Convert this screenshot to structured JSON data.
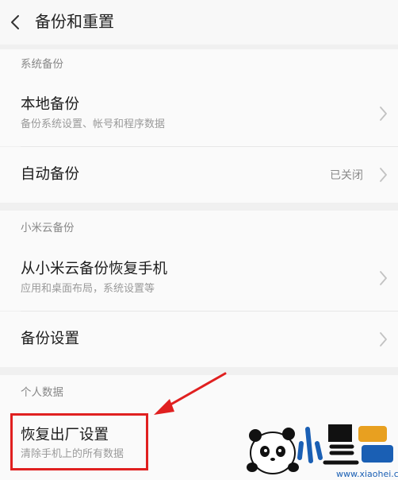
{
  "header": {
    "title": "备份和重置"
  },
  "sections": {
    "system_backup": {
      "title": "系统备份",
      "local_backup": {
        "label": "本地备份",
        "subtitle": "备份系统设置、帐号和程序数据"
      },
      "auto_backup": {
        "label": "自动备份",
        "value": "已关闭"
      }
    },
    "cloud_backup": {
      "title": "小米云备份",
      "restore": {
        "label": "从小米云备份恢复手机",
        "subtitle": "应用和桌面布局，系统设置等"
      },
      "settings": {
        "label": "备份设置"
      }
    },
    "personal_data": {
      "title": "个人数据",
      "factory_reset": {
        "label": "恢复出厂设置",
        "subtitle": "清除手机上的所有数据"
      }
    }
  },
  "annotation": {
    "highlight_color": "#e02020"
  },
  "watermark": {
    "url": "www.xiaohei.com"
  }
}
